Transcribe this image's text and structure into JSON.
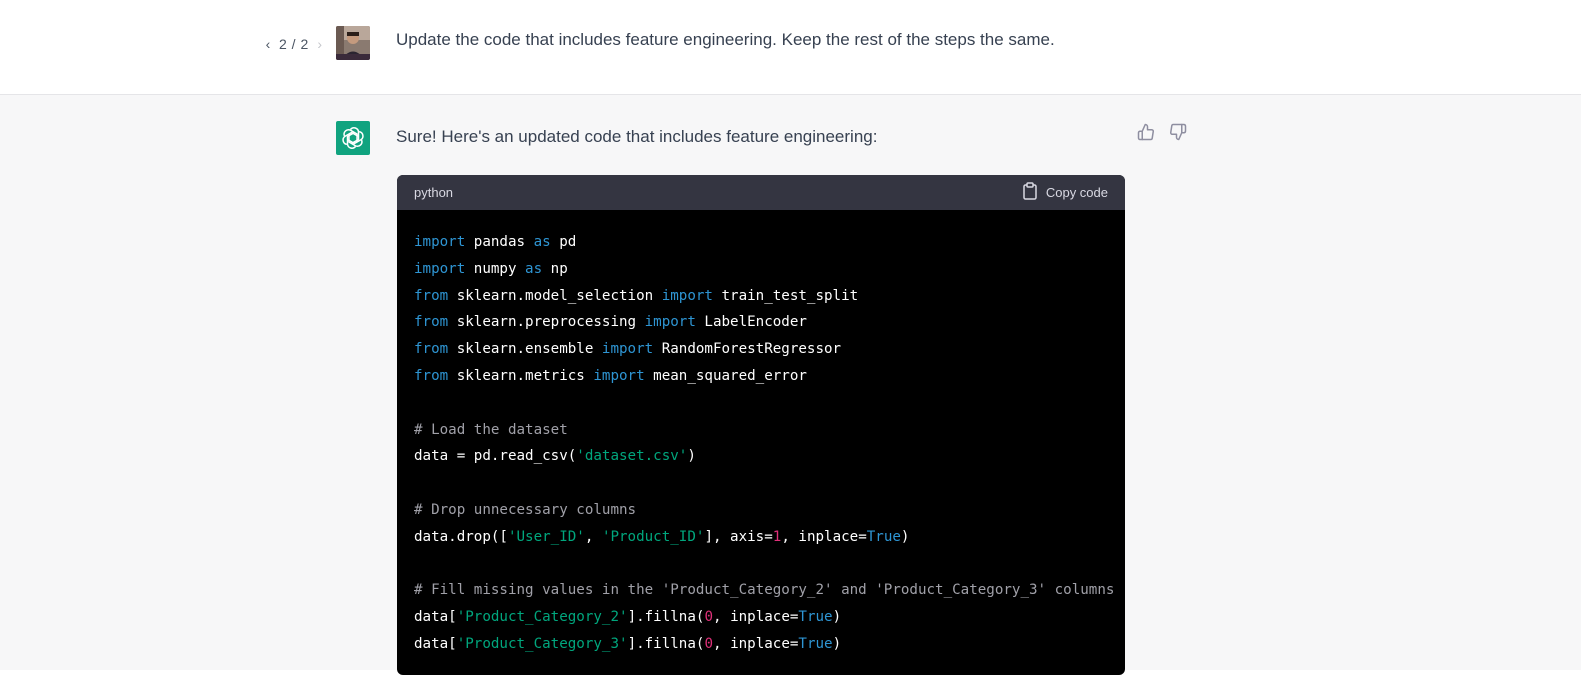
{
  "user_message": {
    "pager": {
      "prev_icon": "chevron-left-icon",
      "count": "2 / 2",
      "next_icon": "chevron-right-icon"
    },
    "text": "Update the code that includes feature engineering. Keep the rest of the steps the same."
  },
  "assistant_message": {
    "text": "Sure! Here's an updated code that includes feature engineering:",
    "feedback": {
      "thumbs_up_icon": "thumbs-up-icon",
      "thumbs_down_icon": "thumbs-down-icon"
    },
    "code_block": {
      "language": "python",
      "copy_label": "Copy code",
      "lines": [
        [
          [
            "kw",
            "import"
          ],
          [
            "plain",
            " pandas "
          ],
          [
            "kw",
            "as"
          ],
          [
            "plain",
            " pd"
          ]
        ],
        [
          [
            "kw",
            "import"
          ],
          [
            "plain",
            " numpy "
          ],
          [
            "kw",
            "as"
          ],
          [
            "plain",
            " np"
          ]
        ],
        [
          [
            "kw",
            "from"
          ],
          [
            "plain",
            " sklearn.model_selection "
          ],
          [
            "kw",
            "import"
          ],
          [
            "plain",
            " train_test_split"
          ]
        ],
        [
          [
            "kw",
            "from"
          ],
          [
            "plain",
            " sklearn.preprocessing "
          ],
          [
            "kw",
            "import"
          ],
          [
            "plain",
            " LabelEncoder"
          ]
        ],
        [
          [
            "kw",
            "from"
          ],
          [
            "plain",
            " sklearn.ensemble "
          ],
          [
            "kw",
            "import"
          ],
          [
            "plain",
            " RandomForestRegressor"
          ]
        ],
        [
          [
            "kw",
            "from"
          ],
          [
            "plain",
            " sklearn.metrics "
          ],
          [
            "kw",
            "import"
          ],
          [
            "plain",
            " mean_squared_error"
          ]
        ],
        [],
        [
          [
            "com",
            "# Load the dataset"
          ]
        ],
        [
          [
            "plain",
            "data = pd.read_csv("
          ],
          [
            "str",
            "'dataset.csv'"
          ],
          [
            "plain",
            ")"
          ]
        ],
        [],
        [
          [
            "com",
            "# Drop unnecessary columns"
          ]
        ],
        [
          [
            "plain",
            "data.drop(["
          ],
          [
            "str",
            "'User_ID'"
          ],
          [
            "plain",
            ", "
          ],
          [
            "str",
            "'Product_ID'"
          ],
          [
            "plain",
            "], axis="
          ],
          [
            "num",
            "1"
          ],
          [
            "plain",
            ", inplace="
          ],
          [
            "kw",
            "True"
          ],
          [
            "plain",
            ")"
          ]
        ],
        [],
        [
          [
            "com",
            "# Fill missing values in the 'Product_Category_2' and 'Product_Category_3' columns"
          ]
        ],
        [
          [
            "plain",
            "data["
          ],
          [
            "str",
            "'Product_Category_2'"
          ],
          [
            "plain",
            "].fillna("
          ],
          [
            "num",
            "0"
          ],
          [
            "plain",
            ", inplace="
          ],
          [
            "kw",
            "True"
          ],
          [
            "plain",
            ")"
          ]
        ],
        [
          [
            "plain",
            "data["
          ],
          [
            "str",
            "'Product_Category_3'"
          ],
          [
            "plain",
            "].fillna("
          ],
          [
            "num",
            "0"
          ],
          [
            "plain",
            ", inplace="
          ],
          [
            "kw",
            "True"
          ],
          [
            "plain",
            ")"
          ]
        ]
      ]
    }
  },
  "colors": {
    "accent": "#10a37f",
    "code_keyword": "#2e95d3",
    "code_string": "#00a67d",
    "code_number": "#df3079",
    "code_comment": "#a0a0a8"
  }
}
